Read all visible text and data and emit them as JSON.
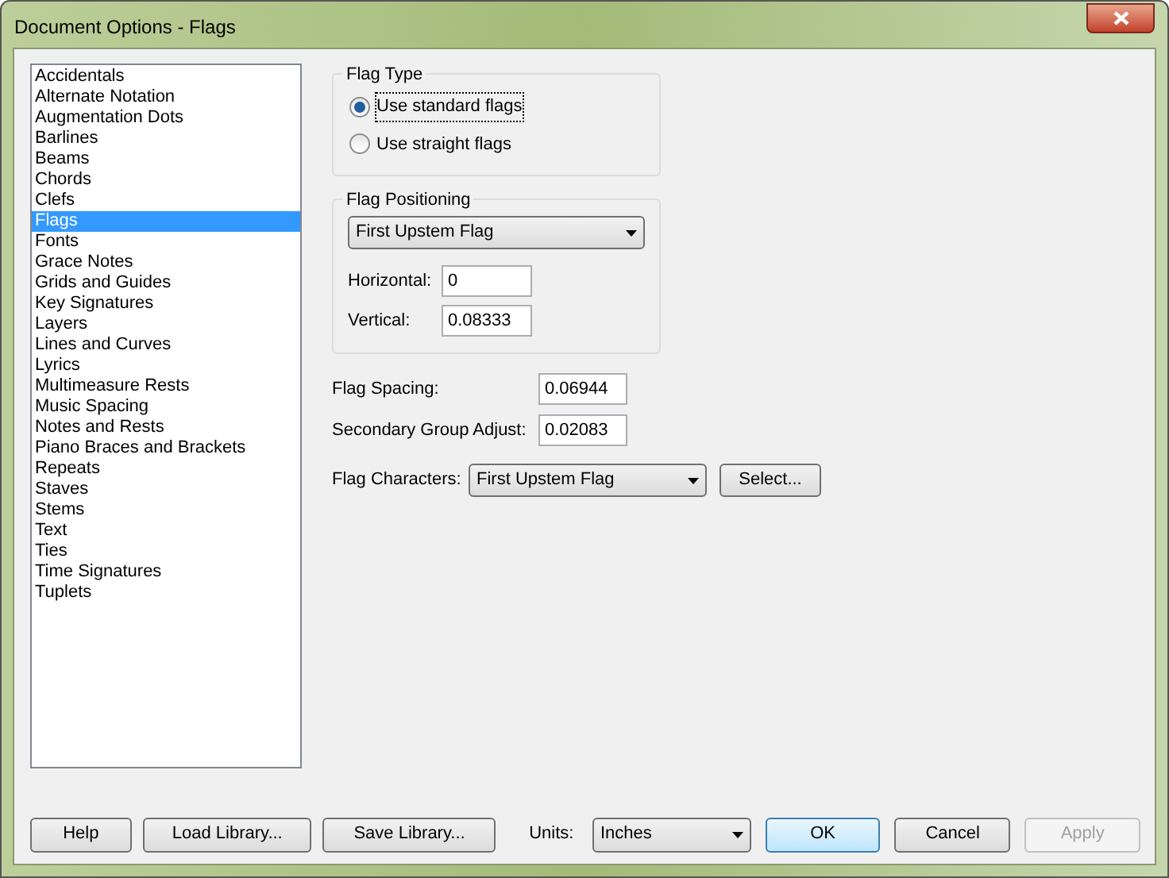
{
  "window": {
    "title": "Document Options - Flags"
  },
  "categories": [
    {
      "label": "Accidentals",
      "selected": false
    },
    {
      "label": "Alternate Notation",
      "selected": false
    },
    {
      "label": "Augmentation Dots",
      "selected": false
    },
    {
      "label": "Barlines",
      "selected": false
    },
    {
      "label": "Beams",
      "selected": false
    },
    {
      "label": "Chords",
      "selected": false
    },
    {
      "label": "Clefs",
      "selected": false
    },
    {
      "label": "Flags",
      "selected": true
    },
    {
      "label": "Fonts",
      "selected": false
    },
    {
      "label": "Grace Notes",
      "selected": false
    },
    {
      "label": "Grids and Guides",
      "selected": false
    },
    {
      "label": "Key Signatures",
      "selected": false
    },
    {
      "label": "Layers",
      "selected": false
    },
    {
      "label": "Lines and Curves",
      "selected": false
    },
    {
      "label": "Lyrics",
      "selected": false
    },
    {
      "label": "Multimeasure Rests",
      "selected": false
    },
    {
      "label": "Music Spacing",
      "selected": false
    },
    {
      "label": "Notes and Rests",
      "selected": false
    },
    {
      "label": "Piano Braces and Brackets",
      "selected": false
    },
    {
      "label": "Repeats",
      "selected": false
    },
    {
      "label": "Staves",
      "selected": false
    },
    {
      "label": "Stems",
      "selected": false
    },
    {
      "label": "Text",
      "selected": false
    },
    {
      "label": "Ties",
      "selected": false
    },
    {
      "label": "Time Signatures",
      "selected": false
    },
    {
      "label": "Tuplets",
      "selected": false
    }
  ],
  "flag_type": {
    "title": "Flag Type",
    "options": [
      {
        "label": "Use standard flags",
        "selected": true
      },
      {
        "label": "Use straight flags",
        "selected": false
      }
    ]
  },
  "flag_positioning": {
    "title": "Flag Positioning",
    "dropdown": "First Upstem Flag",
    "fields": [
      {
        "label": "Horizontal:",
        "value": "0"
      },
      {
        "label": "Vertical:",
        "value": "0.08333"
      }
    ]
  },
  "spacing_fields": [
    {
      "label": "Flag Spacing:",
      "value": "0.06944"
    },
    {
      "label": "Secondary Group Adjust:",
      "value": "0.02083"
    }
  ],
  "flag_characters": {
    "label": "Flag Characters:",
    "dropdown": "First Upstem Flag",
    "button": "Select..."
  },
  "footer": {
    "left_buttons": [
      "Help",
      "Load Library...",
      "Save Library..."
    ],
    "units_label": "Units:",
    "units": "Inches",
    "right_buttons": [
      {
        "label": "OK",
        "default": true,
        "disabled": false
      },
      {
        "label": "Cancel",
        "default": false,
        "disabled": false
      },
      {
        "label": "Apply",
        "default": false,
        "disabled": true
      }
    ]
  }
}
